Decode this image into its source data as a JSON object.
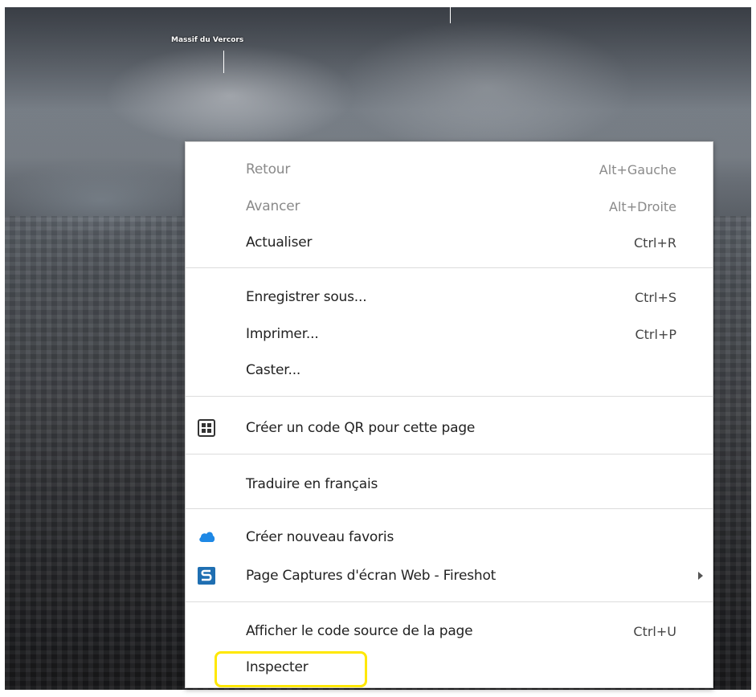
{
  "background": {
    "peak_label": "Massif du Vercors"
  },
  "menu": {
    "items": [
      {
        "label": "Retour",
        "shortcut": "Alt+Gauche",
        "disabled": true
      },
      {
        "label": "Avancer",
        "shortcut": "Alt+Droite",
        "disabled": true
      },
      {
        "label": "Actualiser",
        "shortcut": "Ctrl+R"
      },
      {
        "label": "Enregistrer sous...",
        "shortcut": "Ctrl+S"
      },
      {
        "label": "Imprimer...",
        "shortcut": "Ctrl+P"
      },
      {
        "label": "Caster..."
      },
      {
        "label": "Créer un code QR pour cette page",
        "icon": "qr-code-icon"
      },
      {
        "label": "Traduire en français"
      },
      {
        "label": "Créer nouveau favoris",
        "icon": "cloud-icon"
      },
      {
        "label": "Page Captures d'écran Web - Fireshot",
        "icon": "fireshot-icon",
        "submenu": true
      },
      {
        "label": "Afficher le code source de la page",
        "shortcut": "Ctrl+U"
      },
      {
        "label": "Inspecter"
      }
    ]
  },
  "colors": {
    "highlight": "#ffe800",
    "cloud_icon": "#1e88e5",
    "fireshot_icon": "#1f6fb2"
  }
}
